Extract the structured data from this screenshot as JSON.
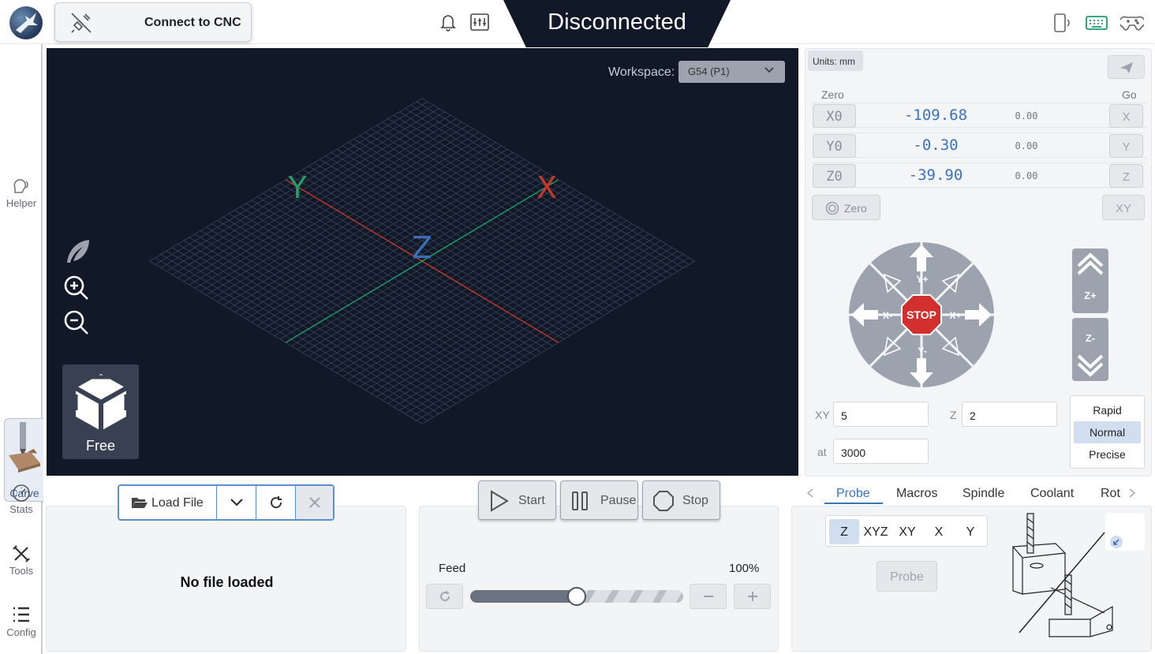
{
  "header": {
    "connect_label": "Connect to CNC",
    "status": "Disconnected"
  },
  "sidebar": {
    "items": [
      {
        "label": "Helper"
      },
      {
        "label": "Carve"
      },
      {
        "label": "Stats"
      },
      {
        "label": "Tools"
      },
      {
        "label": "Config"
      }
    ]
  },
  "visualizer": {
    "workspace_label": "Workspace:",
    "workspace_value": "G54 (P1)",
    "axis_labels": {
      "x": "X",
      "y": "Y",
      "z": "Z"
    },
    "camera_mode": "Free"
  },
  "dro": {
    "units": "Units: mm",
    "zero_header": "Zero",
    "go_header": "Go",
    "axes": [
      {
        "zero_label": "X0",
        "value": "-109.68",
        "machine": "0.00",
        "go_label": "X"
      },
      {
        "zero_label": "Y0",
        "value": "-0.30",
        "machine": "0.00",
        "go_label": "Y"
      },
      {
        "zero_label": "Z0",
        "value": "-39.90",
        "machine": "0.00",
        "go_label": "Z"
      }
    ],
    "zero_all_label": "Zero",
    "go_xy_label": "XY"
  },
  "jog": {
    "labels": {
      "y_plus": "Y+",
      "y_minus": "Y-",
      "x_plus": "X+",
      "x_minus": "X-",
      "stop": "STOP",
      "z_plus": "Z+",
      "z_minus": "Z-"
    },
    "xy_label": "XY",
    "xy_step": "5",
    "z_label": "Z",
    "z_step": "2",
    "at_label": "at",
    "feed": "3000",
    "speeds": [
      {
        "label": "Rapid",
        "active": false
      },
      {
        "label": "Normal",
        "active": true
      },
      {
        "label": "Precise",
        "active": false
      }
    ]
  },
  "file": {
    "load_label": "Load File",
    "empty_text": "No file loaded"
  },
  "job": {
    "start_label": "Start",
    "pause_label": "Pause",
    "stop_label": "Stop",
    "feed_label": "Feed",
    "feed_value": "100%",
    "feed_fraction": 0.5
  },
  "tools": {
    "tabs": [
      "Probe",
      "Macros",
      "Spindle",
      "Coolant",
      "Rot"
    ],
    "active_tab": "Probe",
    "probe_axes": [
      "Z",
      "XYZ",
      "XY",
      "X",
      "Y"
    ],
    "active_probe_axis": "Z",
    "probe_label": "Probe"
  },
  "colors": {
    "accent": "#3b73c0",
    "visualizer_bg": "#111827",
    "x_axis": "#c0392b",
    "y_axis": "#1f9d6f",
    "z_axis": "#3d6db5",
    "stop": "#d32f2f"
  }
}
